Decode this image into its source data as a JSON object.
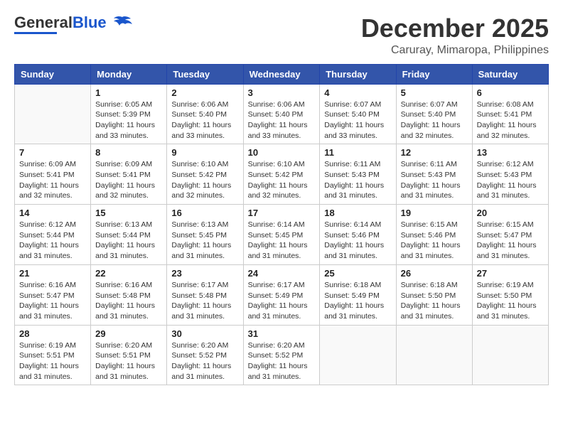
{
  "header": {
    "logo_general": "General",
    "logo_blue": "Blue",
    "month_title": "December 2025",
    "location": "Caruray, Mimaropa, Philippines"
  },
  "weekdays": [
    "Sunday",
    "Monday",
    "Tuesday",
    "Wednesday",
    "Thursday",
    "Friday",
    "Saturday"
  ],
  "weeks": [
    [
      {
        "day": "",
        "info": ""
      },
      {
        "day": "1",
        "info": "Sunrise: 6:05 AM\nSunset: 5:39 PM\nDaylight: 11 hours\nand 33 minutes."
      },
      {
        "day": "2",
        "info": "Sunrise: 6:06 AM\nSunset: 5:40 PM\nDaylight: 11 hours\nand 33 minutes."
      },
      {
        "day": "3",
        "info": "Sunrise: 6:06 AM\nSunset: 5:40 PM\nDaylight: 11 hours\nand 33 minutes."
      },
      {
        "day": "4",
        "info": "Sunrise: 6:07 AM\nSunset: 5:40 PM\nDaylight: 11 hours\nand 33 minutes."
      },
      {
        "day": "5",
        "info": "Sunrise: 6:07 AM\nSunset: 5:40 PM\nDaylight: 11 hours\nand 32 minutes."
      },
      {
        "day": "6",
        "info": "Sunrise: 6:08 AM\nSunset: 5:41 PM\nDaylight: 11 hours\nand 32 minutes."
      }
    ],
    [
      {
        "day": "7",
        "info": "Sunrise: 6:09 AM\nSunset: 5:41 PM\nDaylight: 11 hours\nand 32 minutes."
      },
      {
        "day": "8",
        "info": "Sunrise: 6:09 AM\nSunset: 5:41 PM\nDaylight: 11 hours\nand 32 minutes."
      },
      {
        "day": "9",
        "info": "Sunrise: 6:10 AM\nSunset: 5:42 PM\nDaylight: 11 hours\nand 32 minutes."
      },
      {
        "day": "10",
        "info": "Sunrise: 6:10 AM\nSunset: 5:42 PM\nDaylight: 11 hours\nand 32 minutes."
      },
      {
        "day": "11",
        "info": "Sunrise: 6:11 AM\nSunset: 5:43 PM\nDaylight: 11 hours\nand 31 minutes."
      },
      {
        "day": "12",
        "info": "Sunrise: 6:11 AM\nSunset: 5:43 PM\nDaylight: 11 hours\nand 31 minutes."
      },
      {
        "day": "13",
        "info": "Sunrise: 6:12 AM\nSunset: 5:43 PM\nDaylight: 11 hours\nand 31 minutes."
      }
    ],
    [
      {
        "day": "14",
        "info": "Sunrise: 6:12 AM\nSunset: 5:44 PM\nDaylight: 11 hours\nand 31 minutes."
      },
      {
        "day": "15",
        "info": "Sunrise: 6:13 AM\nSunset: 5:44 PM\nDaylight: 11 hours\nand 31 minutes."
      },
      {
        "day": "16",
        "info": "Sunrise: 6:13 AM\nSunset: 5:45 PM\nDaylight: 11 hours\nand 31 minutes."
      },
      {
        "day": "17",
        "info": "Sunrise: 6:14 AM\nSunset: 5:45 PM\nDaylight: 11 hours\nand 31 minutes."
      },
      {
        "day": "18",
        "info": "Sunrise: 6:14 AM\nSunset: 5:46 PM\nDaylight: 11 hours\nand 31 minutes."
      },
      {
        "day": "19",
        "info": "Sunrise: 6:15 AM\nSunset: 5:46 PM\nDaylight: 11 hours\nand 31 minutes."
      },
      {
        "day": "20",
        "info": "Sunrise: 6:15 AM\nSunset: 5:47 PM\nDaylight: 11 hours\nand 31 minutes."
      }
    ],
    [
      {
        "day": "21",
        "info": "Sunrise: 6:16 AM\nSunset: 5:47 PM\nDaylight: 11 hours\nand 31 minutes."
      },
      {
        "day": "22",
        "info": "Sunrise: 6:16 AM\nSunset: 5:48 PM\nDaylight: 11 hours\nand 31 minutes."
      },
      {
        "day": "23",
        "info": "Sunrise: 6:17 AM\nSunset: 5:48 PM\nDaylight: 11 hours\nand 31 minutes."
      },
      {
        "day": "24",
        "info": "Sunrise: 6:17 AM\nSunset: 5:49 PM\nDaylight: 11 hours\nand 31 minutes."
      },
      {
        "day": "25",
        "info": "Sunrise: 6:18 AM\nSunset: 5:49 PM\nDaylight: 11 hours\nand 31 minutes."
      },
      {
        "day": "26",
        "info": "Sunrise: 6:18 AM\nSunset: 5:50 PM\nDaylight: 11 hours\nand 31 minutes."
      },
      {
        "day": "27",
        "info": "Sunrise: 6:19 AM\nSunset: 5:50 PM\nDaylight: 11 hours\nand 31 minutes."
      }
    ],
    [
      {
        "day": "28",
        "info": "Sunrise: 6:19 AM\nSunset: 5:51 PM\nDaylight: 11 hours\nand 31 minutes."
      },
      {
        "day": "29",
        "info": "Sunrise: 6:20 AM\nSunset: 5:51 PM\nDaylight: 11 hours\nand 31 minutes."
      },
      {
        "day": "30",
        "info": "Sunrise: 6:20 AM\nSunset: 5:52 PM\nDaylight: 11 hours\nand 31 minutes."
      },
      {
        "day": "31",
        "info": "Sunrise: 6:20 AM\nSunset: 5:52 PM\nDaylight: 11 hours\nand 31 minutes."
      },
      {
        "day": "",
        "info": ""
      },
      {
        "day": "",
        "info": ""
      },
      {
        "day": "",
        "info": ""
      }
    ]
  ]
}
